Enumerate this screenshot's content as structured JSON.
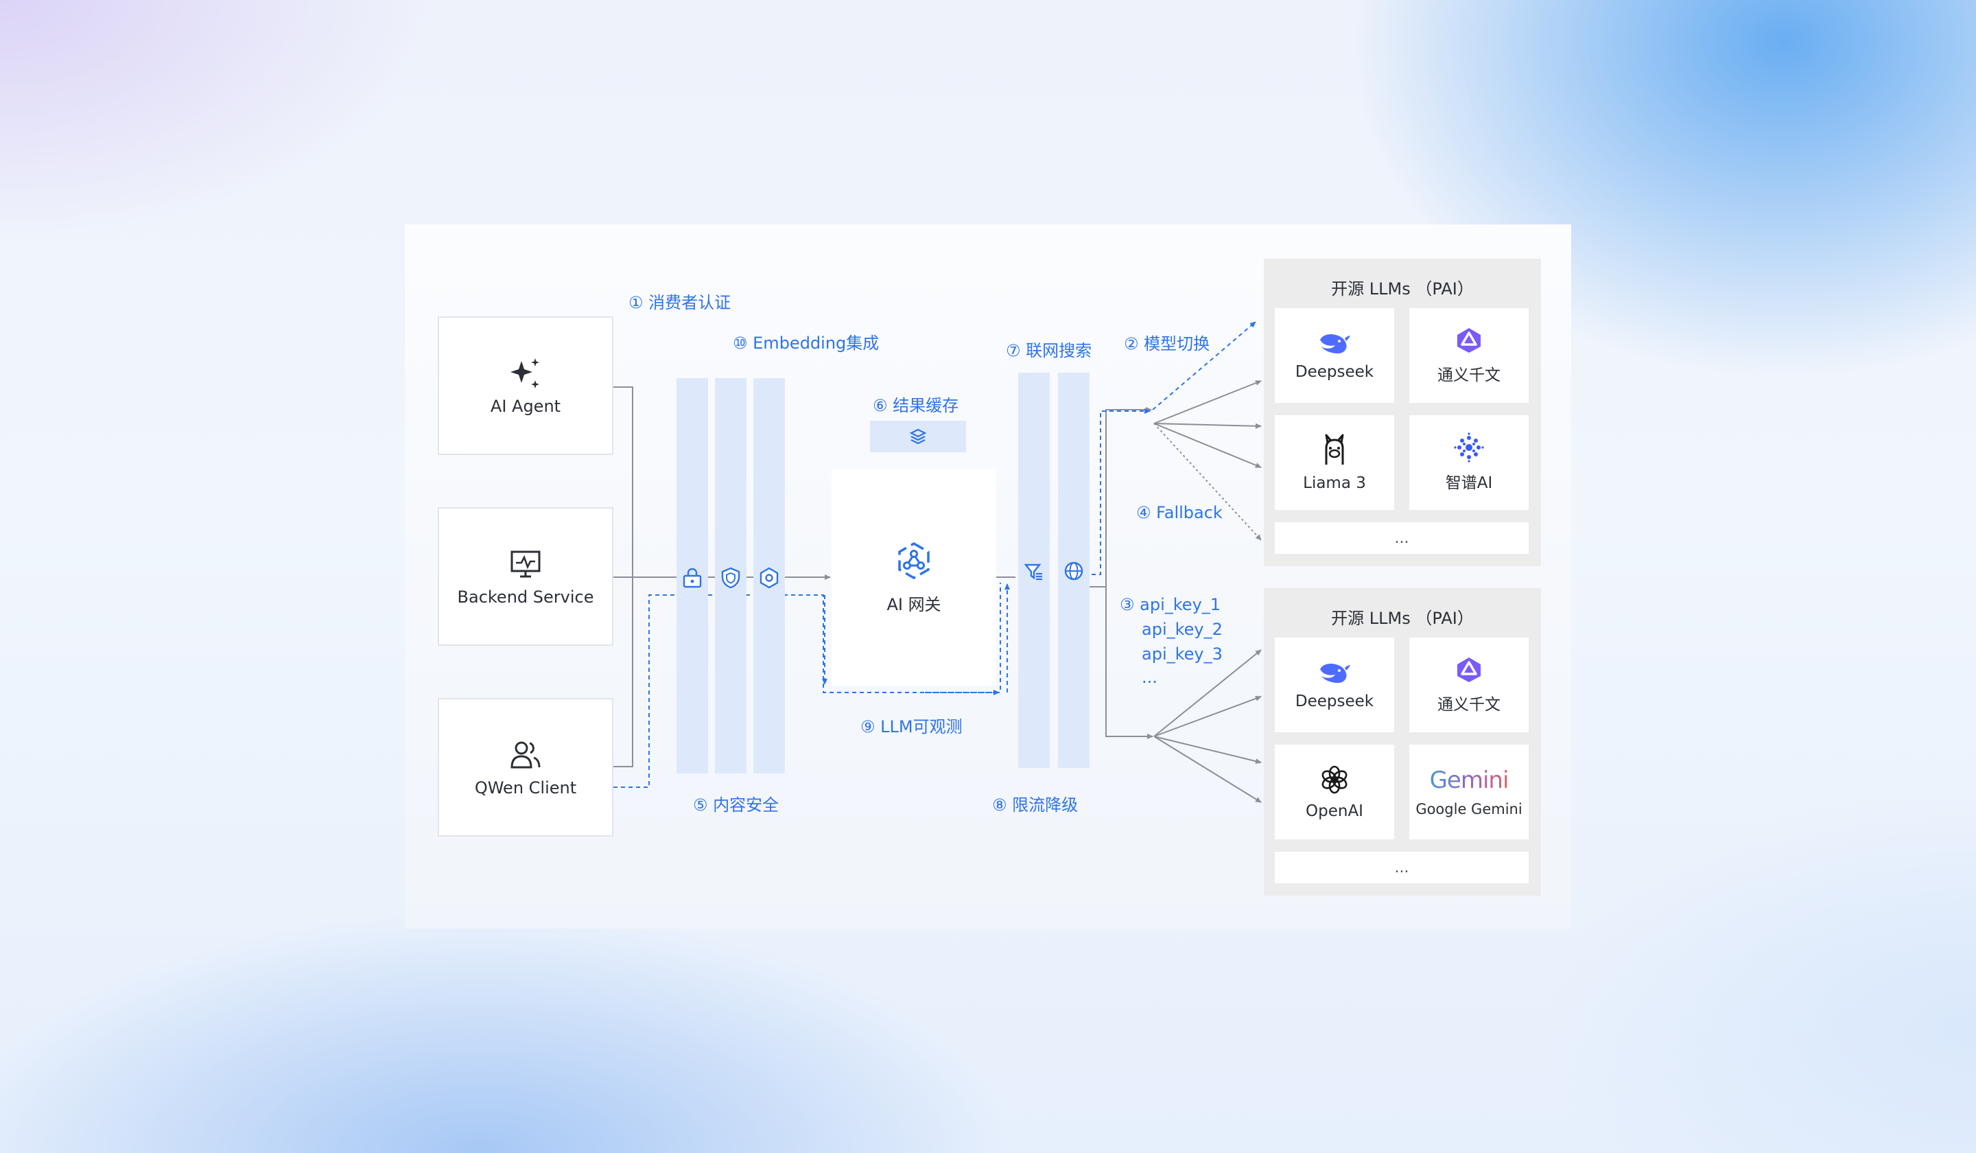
{
  "clients": [
    {
      "label": "AI Agent",
      "icon": "sparkle-icon"
    },
    {
      "label": "Backend Service",
      "icon": "monitor-icon"
    },
    {
      "label": "QWen Client",
      "icon": "users-icon"
    }
  ],
  "steps": {
    "s1": "① 消费者认证",
    "s10": "⑩ Embedding集成",
    "s6": "⑥ 结果缓存",
    "s7": "⑦ 联网搜索",
    "s2": "② 模型切换",
    "s4": "④ Fallback",
    "s3_1": "③ api_key_1",
    "s3_2": "api_key_2",
    "s3_3": "api_key_3",
    "s3_more": "...",
    "s9": "⑨ LLM可观测",
    "s5": "⑤ 内容安全",
    "s8": "⑧ 限流降级"
  },
  "gateway": {
    "label": "AI 网关",
    "icon": "gateway-icon"
  },
  "groups": [
    {
      "title": "开源 LLMs （PAI）",
      "models": [
        {
          "name": "Deepseek",
          "icon": "deepseek-whale-icon"
        },
        {
          "name": "通义千文",
          "icon": "qwen-icon"
        },
        {
          "name": "Liama 3",
          "icon": "llama-icon"
        },
        {
          "name": "智谱AI",
          "icon": "zhipu-icon"
        }
      ],
      "more": "..."
    },
    {
      "title": "开源 LLMs （PAI）",
      "models": [
        {
          "name": "Deepseek",
          "icon": "deepseek-whale-icon"
        },
        {
          "name": "通义千文",
          "icon": "qwen-icon"
        },
        {
          "name": "OpenAI",
          "icon": "openai-icon"
        },
        {
          "name": "Google Gemini",
          "icon": "gemini-icon",
          "logo_text": "Gemini"
        }
      ],
      "more": "..."
    }
  ],
  "colors": {
    "accent": "#2f74e6",
    "column": "#dde9fb",
    "line": "#8a8f98"
  }
}
